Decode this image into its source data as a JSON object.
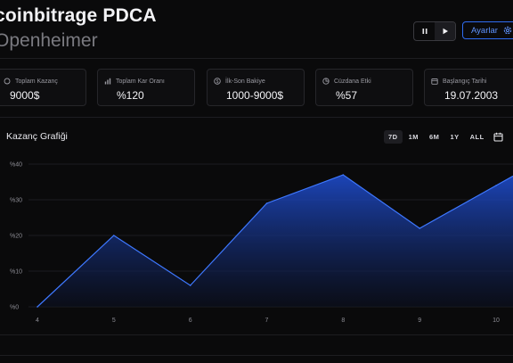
{
  "header": {
    "title": "coinbitrage PDCA",
    "subtitle": "Openheimer",
    "settings_label": "Ayarlar"
  },
  "stats": [
    {
      "label": "Toplam Kazanç",
      "value": "9000$",
      "icon": "coins-icon"
    },
    {
      "label": "Toplam Kar Oranı",
      "value": "%120",
      "icon": "bar-chart-icon"
    },
    {
      "label": "İlk-Son Bakiye",
      "value": "1000-9000$",
      "icon": "dollar-circle-icon"
    },
    {
      "label": "Cüzdana Etki",
      "value": "%57",
      "icon": "pie-chart-icon"
    },
    {
      "label": "Başlangıç Tarihi",
      "value": "19.07.2003",
      "icon": "calendar-icon"
    }
  ],
  "chart_section": {
    "title": "Kazanç Grafiği",
    "ranges": [
      "7D",
      "1M",
      "6M",
      "1Y",
      "ALL"
    ],
    "active_range": "7D"
  },
  "colors": {
    "accent": "#2f6cf0",
    "background": "#0a0a0b",
    "card_border": "#26262a"
  },
  "chart_data": {
    "type": "area",
    "x": [
      4,
      5,
      6,
      7,
      8,
      9,
      10
    ],
    "values": [
      0,
      20,
      6,
      29,
      37,
      22,
      34
    ],
    "yticks": [
      "%0",
      "%10",
      "%20",
      "%30",
      "%40"
    ],
    "ylim": [
      0,
      40
    ],
    "xlim": [
      4,
      10.2
    ],
    "grid": true,
    "xlabel": "",
    "ylabel": ""
  }
}
